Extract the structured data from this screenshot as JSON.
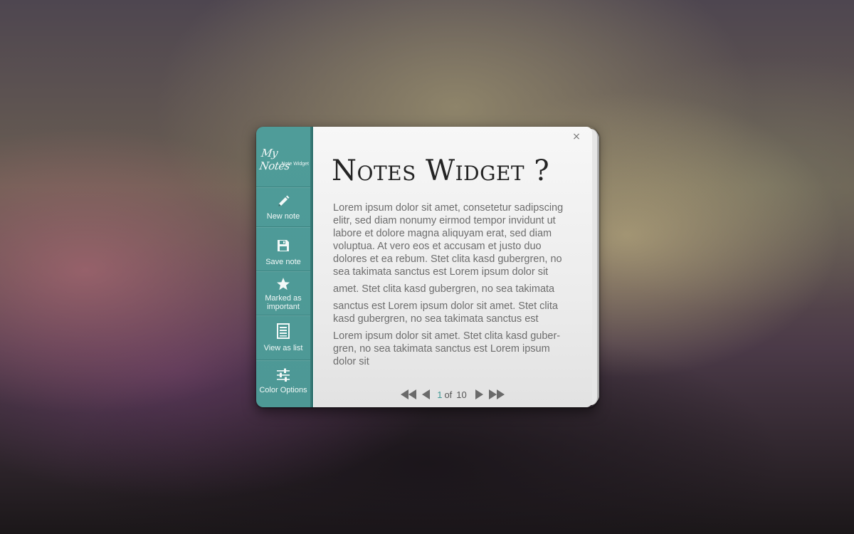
{
  "widget": {
    "logo": {
      "script": "My Notes",
      "subtitle": "Note Widget"
    },
    "close_label": "×",
    "nav": [
      {
        "label": "New note",
        "icon": "pencil-icon"
      },
      {
        "label": "Save note",
        "icon": "floppy-disk-icon"
      },
      {
        "label": "Marked as important",
        "icon": "star-icon"
      },
      {
        "label": "View as list",
        "icon": "list-icon"
      },
      {
        "label": "Color Options",
        "icon": "sliders-icon"
      }
    ],
    "note": {
      "title": "Notes Widget ?",
      "paragraphs": [
        "Lorem ipsum dolor sit amet, consetetur sadipscing elitr, sed diam nonumy eirmod tempor invidunt ut labore et dolore magna aliquyam erat, sed diam voluptua. At vero eos et accusam et justo duo dolores et ea rebum. Stet clita kasd gubergren, no sea takimata sanctus est Lorem ipsum dolor sit",
        "amet. Stet clita kasd gubergren, no sea takimata",
        "sanctus est Lorem ipsum dolor sit amet. Stet clita kasd gubergren, no sea takimata sanctus est",
        "Lorem ipsum dolor sit amet. Stet clita kasd guber-gren, no sea takimata sanctus est Lorem ipsum dolor sit"
      ]
    },
    "pager": {
      "current": "1",
      "separator": "of",
      "total": "10"
    }
  },
  "colors": {
    "sidebar": "#4f9c99",
    "accent": "#3f9794",
    "content_bg": "#f0f0f0",
    "body_text": "#6d6d6d",
    "title_text": "#242424"
  }
}
